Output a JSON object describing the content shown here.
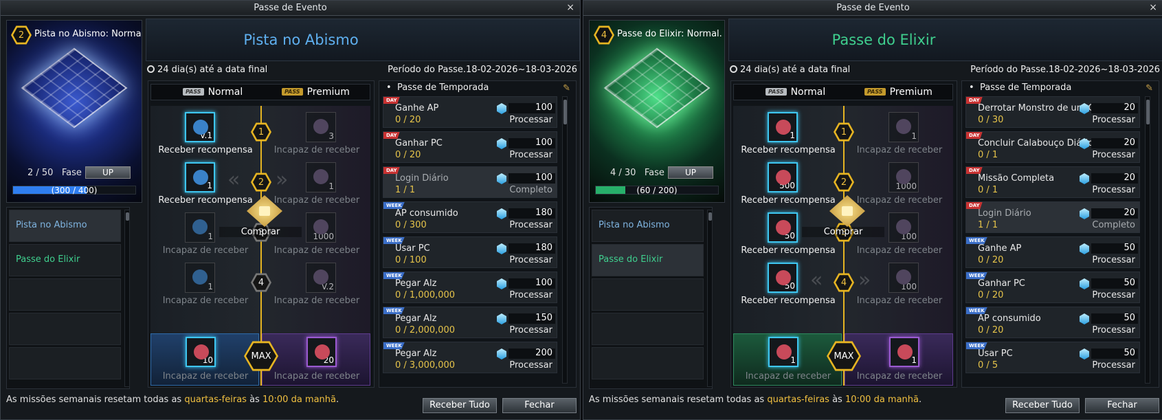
{
  "windows": [
    {
      "title": "Passe de Evento",
      "close": "×",
      "level": "2",
      "emblem_name": "Pista no Abismo: Normal.",
      "fase_value": "2 / 50",
      "fase_label": "Fase",
      "up": "UP",
      "xp": "(300 / 400)",
      "xp_fraction": 0.75,
      "nav": [
        "Pista no Abismo",
        "Passe do Elixir"
      ],
      "banner": "Pista no Abismo",
      "days": "24 dia(s) até a data final",
      "period": "Período do Passe.18-02-2026~18-03-2026",
      "tabs": {
        "normal": "Normal",
        "premium": "Premium",
        "pass": "PASS"
      },
      "track": {
        "nodes": [
          "1",
          "2",
          "3",
          "4"
        ],
        "normal": [
          {
            "count": "V.1",
            "label": "Receber recompensa"
          },
          {
            "count": "1",
            "label": "Receber recompensa"
          },
          {
            "count": "1",
            "label": "Incapaz de receber"
          },
          {
            "count": "1",
            "label": "Incapaz de receber"
          }
        ],
        "premium": [
          {
            "count": "3",
            "label": "Incapaz de receber"
          },
          {
            "count": "1",
            "label": "Incapaz de receber"
          },
          {
            "count": "1000",
            "label": "Incapaz de receber"
          },
          {
            "count": "V.2",
            "label": "Incapaz de receber"
          }
        ],
        "buy": "Comprar",
        "max": "MAX",
        "max_normal": {
          "count": "10",
          "label": "Incapaz de receber"
        },
        "max_premium": {
          "count": "20",
          "label": "Incapaz de receber"
        }
      },
      "season_title": "Passe de Temporada",
      "missions": [
        {
          "tag": "DAY",
          "name": "Ganhe AP",
          "progress": "0 / 20",
          "reward": "100",
          "status": "Processar"
        },
        {
          "tag": "DAY",
          "name": "Ganhar PC",
          "progress": "0 / 20",
          "reward": "100",
          "status": "Processar"
        },
        {
          "tag": "DAY",
          "name": "Login Diário",
          "progress": "1 / 1",
          "reward": "100",
          "status": "Completo"
        },
        {
          "tag": "WEEK",
          "name": "AP consumido",
          "progress": "0 / 300",
          "reward": "180",
          "status": "Processar"
        },
        {
          "tag": "WEEK",
          "name": "Usar PC",
          "progress": "0 / 100",
          "reward": "180",
          "status": "Processar"
        },
        {
          "tag": "WEEK",
          "name": "Pegar Alz",
          "progress": "0 / 1,000,000",
          "reward": "100",
          "status": "Processar"
        },
        {
          "tag": "WEEK",
          "name": "Pegar Alz",
          "progress": "0 / 2,000,000",
          "reward": "150",
          "status": "Processar"
        },
        {
          "tag": "WEEK",
          "name": "Pegar Alz",
          "progress": "0 / 3,000,000",
          "reward": "200",
          "status": "Processar"
        }
      ],
      "footer_a": "As missões semanais resetam todas as ",
      "footer_hl": "quartas-feiras",
      "footer_b": " às ",
      "footer_hl2": "10:00 da manhã",
      "footer_c": ".",
      "receive_all": "Receber Tudo",
      "close_btn": "Fechar"
    },
    {
      "title": "Passe de Evento",
      "close": "×",
      "level": "4",
      "emblem_name": "Passe do Elixir: Normal.",
      "fase_value": "4 / 30",
      "fase_label": "Fase",
      "up": "UP",
      "xp": "(60 / 200)",
      "xp_fraction": 0.3,
      "nav": [
        "Pista no Abismo",
        "Passe do Elixir"
      ],
      "banner": "Passe do Elixir",
      "days": "24 dia(s) até a data final",
      "period": "Período do Passe.18-02-2026~18-03-2026",
      "tabs": {
        "normal": "Normal",
        "premium": "Premium",
        "pass": "PASS"
      },
      "track": {
        "nodes": [
          "1",
          "2",
          "3",
          "4"
        ],
        "normal": [
          {
            "count": "1",
            "label": "Receber recompensa"
          },
          {
            "count": "500",
            "label": "Receber recompensa"
          },
          {
            "count": "50",
            "label": "Receber recompensa"
          },
          {
            "count": "50",
            "label": "Receber recompensa"
          }
        ],
        "premium": [
          {
            "count": "1",
            "label": "Incapaz de receber"
          },
          {
            "count": "1000",
            "label": "Incapaz de receber"
          },
          {
            "count": "100",
            "label": "Incapaz de receber"
          },
          {
            "count": "100",
            "label": "Incapaz de receber"
          }
        ],
        "buy": "Comprar",
        "max": "MAX",
        "max_normal": {
          "count": "1",
          "label": "Incapaz de receber"
        },
        "max_premium": {
          "count": "1",
          "label": "Incapaz de receber"
        }
      },
      "season_title": "Passe de Temporada",
      "missions": [
        {
          "tag": "DAY",
          "name": "Derrotar Monstro de um Calabouço",
          "progress": "0 / 30",
          "reward": "20",
          "status": "Processar"
        },
        {
          "tag": "DAY",
          "name": "Concluir Calabouço Diário",
          "progress": "0 / 1",
          "reward": "20",
          "status": "Processar"
        },
        {
          "tag": "DAY",
          "name": "Missão Completa",
          "progress": "0 / 1",
          "reward": "20",
          "status": "Processar"
        },
        {
          "tag": "DAY",
          "name": "Login Diário",
          "progress": "1 / 1",
          "reward": "20",
          "status": "Completo"
        },
        {
          "tag": "WEEK",
          "name": "Ganhe AP",
          "progress": "0 / 20",
          "reward": "50",
          "status": "Processar"
        },
        {
          "tag": "WEEK",
          "name": "Ganhar PC",
          "progress": "0 / 20",
          "reward": "50",
          "status": "Processar"
        },
        {
          "tag": "WEEK",
          "name": "AP consumido",
          "progress": "0 / 20",
          "reward": "50",
          "status": "Processar"
        },
        {
          "tag": "WEEK",
          "name": "Usar PC",
          "progress": "0 / 5",
          "reward": "50",
          "status": "Processar"
        }
      ],
      "footer_a": "As missões semanais resetam todas as ",
      "footer_hl": "quartas-feiras",
      "footer_b": " às ",
      "footer_hl2": "10:00 da manhã",
      "footer_c": ".",
      "receive_all": "Receber Tudo",
      "close_btn": "Fechar"
    }
  ],
  "colors": {
    "abyss_accent": "#5fb0f0",
    "elixir_accent": "#3fcf8e",
    "xp_abyss": "#2f7ef0",
    "xp_elixir": "#27b06a",
    "gold": "#e6b422"
  }
}
